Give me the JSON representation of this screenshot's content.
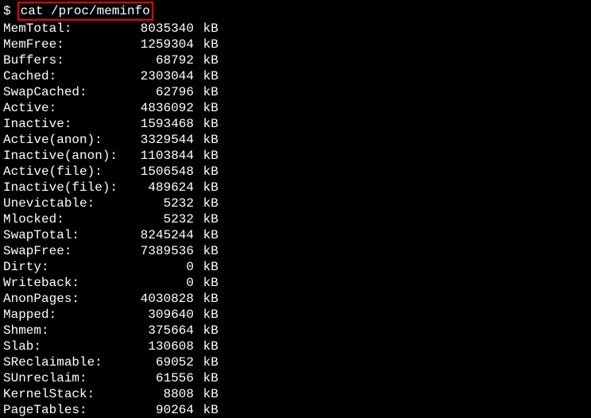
{
  "prompt": "$",
  "command": "cat /proc/meminfo",
  "unit": "kB",
  "rows": [
    {
      "name": "MemTotal:",
      "value": "8035340"
    },
    {
      "name": "MemFree:",
      "value": "1259304"
    },
    {
      "name": "Buffers:",
      "value": "68792"
    },
    {
      "name": "Cached:",
      "value": "2303044"
    },
    {
      "name": "SwapCached:",
      "value": "62796"
    },
    {
      "name": "Active:",
      "value": "4836092"
    },
    {
      "name": "Inactive:",
      "value": "1593468"
    },
    {
      "name": "Active(anon):",
      "value": "3329544"
    },
    {
      "name": "Inactive(anon):",
      "value": "1103844"
    },
    {
      "name": "Active(file):",
      "value": "1506548"
    },
    {
      "name": "Inactive(file):",
      "value": "489624"
    },
    {
      "name": "Unevictable:",
      "value": "5232"
    },
    {
      "name": "Mlocked:",
      "value": "5232"
    },
    {
      "name": "SwapTotal:",
      "value": "8245244"
    },
    {
      "name": "SwapFree:",
      "value": "7389536"
    },
    {
      "name": "Dirty:",
      "value": "0"
    },
    {
      "name": "Writeback:",
      "value": "0"
    },
    {
      "name": "AnonPages:",
      "value": "4030828"
    },
    {
      "name": "Mapped:",
      "value": "309640"
    },
    {
      "name": "Shmem:",
      "value": "375664"
    },
    {
      "name": "Slab:",
      "value": "130608"
    },
    {
      "name": "SReclaimable:",
      "value": "69052"
    },
    {
      "name": "SUnreclaim:",
      "value": "61556"
    },
    {
      "name": "KernelStack:",
      "value": "8808"
    },
    {
      "name": "PageTables:",
      "value": "90264"
    }
  ]
}
